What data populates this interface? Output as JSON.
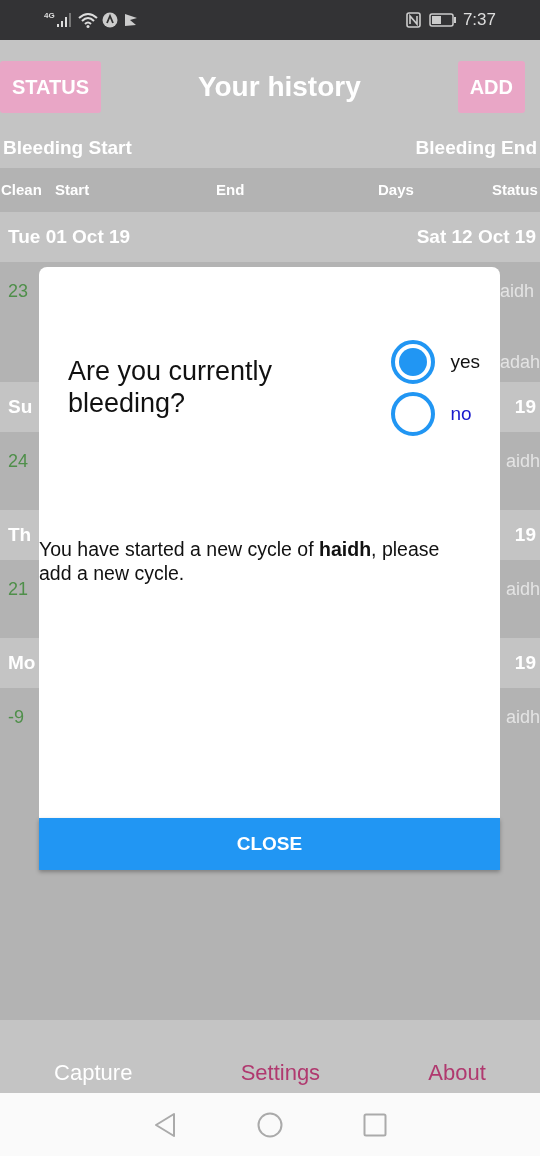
{
  "status_bar": {
    "network": "4G",
    "time": "7:37"
  },
  "header": {
    "left_button": "STATUS",
    "title": "Your history",
    "right_button": "ADD"
  },
  "summary_labels": [
    "Bleeding Start",
    "Bleeding End"
  ],
  "columns": [
    "Clean",
    "Start",
    "End",
    "Days",
    "Status"
  ],
  "cycles": [
    {
      "start": "Tue 01 Oct 19",
      "end": "Sat 12 Oct 19",
      "clean": "23",
      "status_lines": [
        "aidh",
        "adah"
      ]
    },
    {
      "start": "Su",
      "end": "19",
      "clean": "24",
      "status_lines": [
        "aidh"
      ]
    },
    {
      "start": "Th",
      "end": "19",
      "clean": "21",
      "status_lines": [
        "aidh"
      ]
    },
    {
      "start": "Mo",
      "end": "19",
      "clean": "-9",
      "status_lines": [
        "aidh"
      ]
    }
  ],
  "dialog": {
    "question": "Are you currently bleeding?",
    "options": [
      {
        "label": "yes",
        "selected": true
      },
      {
        "label": "no",
        "selected": false
      }
    ],
    "message": "You have started a new cycle of **haidh**, please add a new cycle.",
    "close_button": "CLOSE"
  },
  "tabs": [
    {
      "label": "Capture",
      "selected": true
    },
    {
      "label": "Settings",
      "selected": false
    },
    {
      "label": "About",
      "selected": false
    }
  ]
}
